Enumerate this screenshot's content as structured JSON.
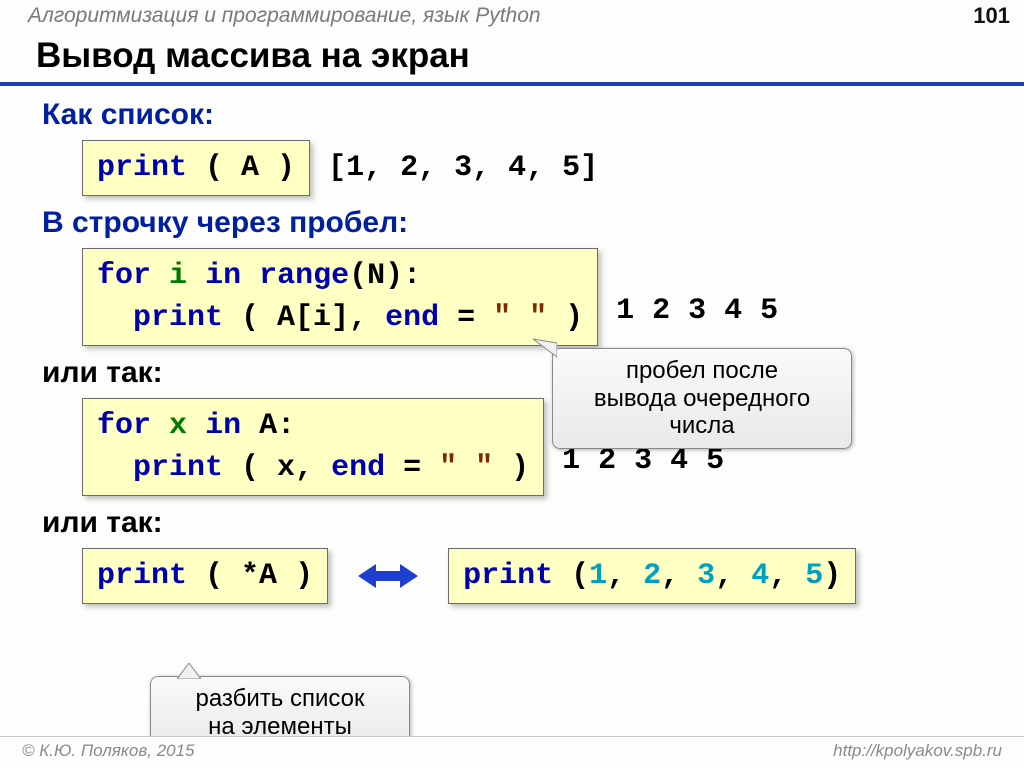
{
  "header": {
    "course": "Алгоритмизация и программирование, язык Python",
    "page": "101"
  },
  "title": "Вывод массива на экран",
  "sections": {
    "as_list": {
      "label": "Как список:",
      "code": {
        "print": "print",
        "open": " ( ",
        "arg": "A",
        "close": " )"
      },
      "output": "[1, 2, 3, 4, 5]"
    },
    "space_line": {
      "label": "В строчку через пробел:",
      "code": {
        "line1": {
          "for": "for",
          "i": "i",
          "in": "in",
          "range": "range",
          "open": "(",
          "N": "N",
          "close": "):"
        },
        "line2": {
          "print": "print",
          "open": " ( ",
          "ai": "A[i]",
          "comma": ", ",
          "end": "end",
          "eq": " = ",
          "str": "\" \"",
          "close": " )"
        }
      },
      "output": "1 2 3 4 5",
      "note": "пробел после\nвывода очередного\nчисла"
    },
    "alt1": {
      "label": "или так:",
      "code": {
        "line1": {
          "for": "for",
          "x": "x",
          "in": "in",
          "A": "A",
          "colon": ":"
        },
        "line2": {
          "print": "print",
          "open": " ( ",
          "x": "x",
          "comma": ", ",
          "end": "end",
          "eq": " = ",
          "str": "\" \"",
          "close": " )"
        }
      },
      "output": "1 2 3 4 5"
    },
    "alt2": {
      "label": "или так:",
      "left": {
        "print": "print",
        "open": " ( ",
        "star": "*",
        "A": "A",
        "close": " )"
      },
      "right": {
        "print": "print",
        "open": " (",
        "n1": "1",
        "c": ", ",
        "n2": "2",
        "n3": "3",
        "n4": "4",
        "n5": "5",
        "close": ")"
      },
      "note": "разбить список\nна элементы"
    }
  },
  "footer": {
    "copy": "© К.Ю. Поляков, 2015",
    "url": "http://kpolyakov.spb.ru"
  }
}
